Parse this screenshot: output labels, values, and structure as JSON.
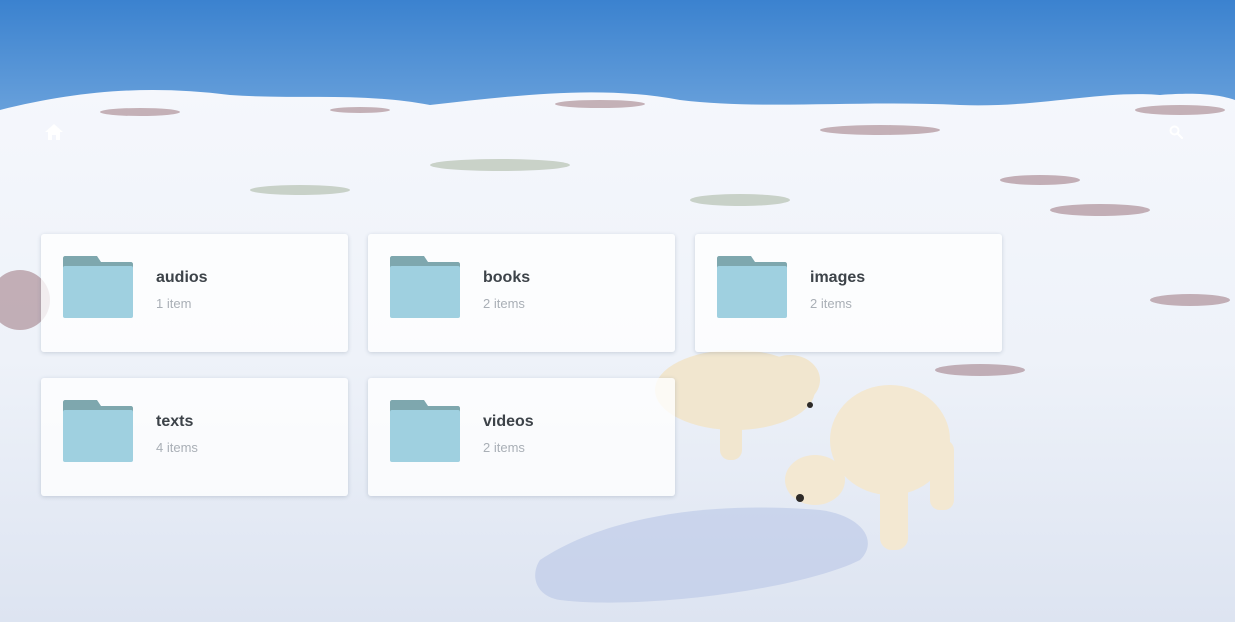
{
  "toolbar": {
    "home_icon": "home-icon",
    "search_icon": "search-icon"
  },
  "colors": {
    "folder_body": "#9fd0e0",
    "folder_tab": "#7ea7ae",
    "title_text": "#3d4349",
    "subtitle_text": "#a9afb6"
  },
  "folders": [
    {
      "name": "audios",
      "count": "1 item"
    },
    {
      "name": "books",
      "count": "2 items"
    },
    {
      "name": "images",
      "count": "2 items"
    },
    {
      "name": "texts",
      "count": "4 items"
    },
    {
      "name": "videos",
      "count": "2 items"
    }
  ]
}
